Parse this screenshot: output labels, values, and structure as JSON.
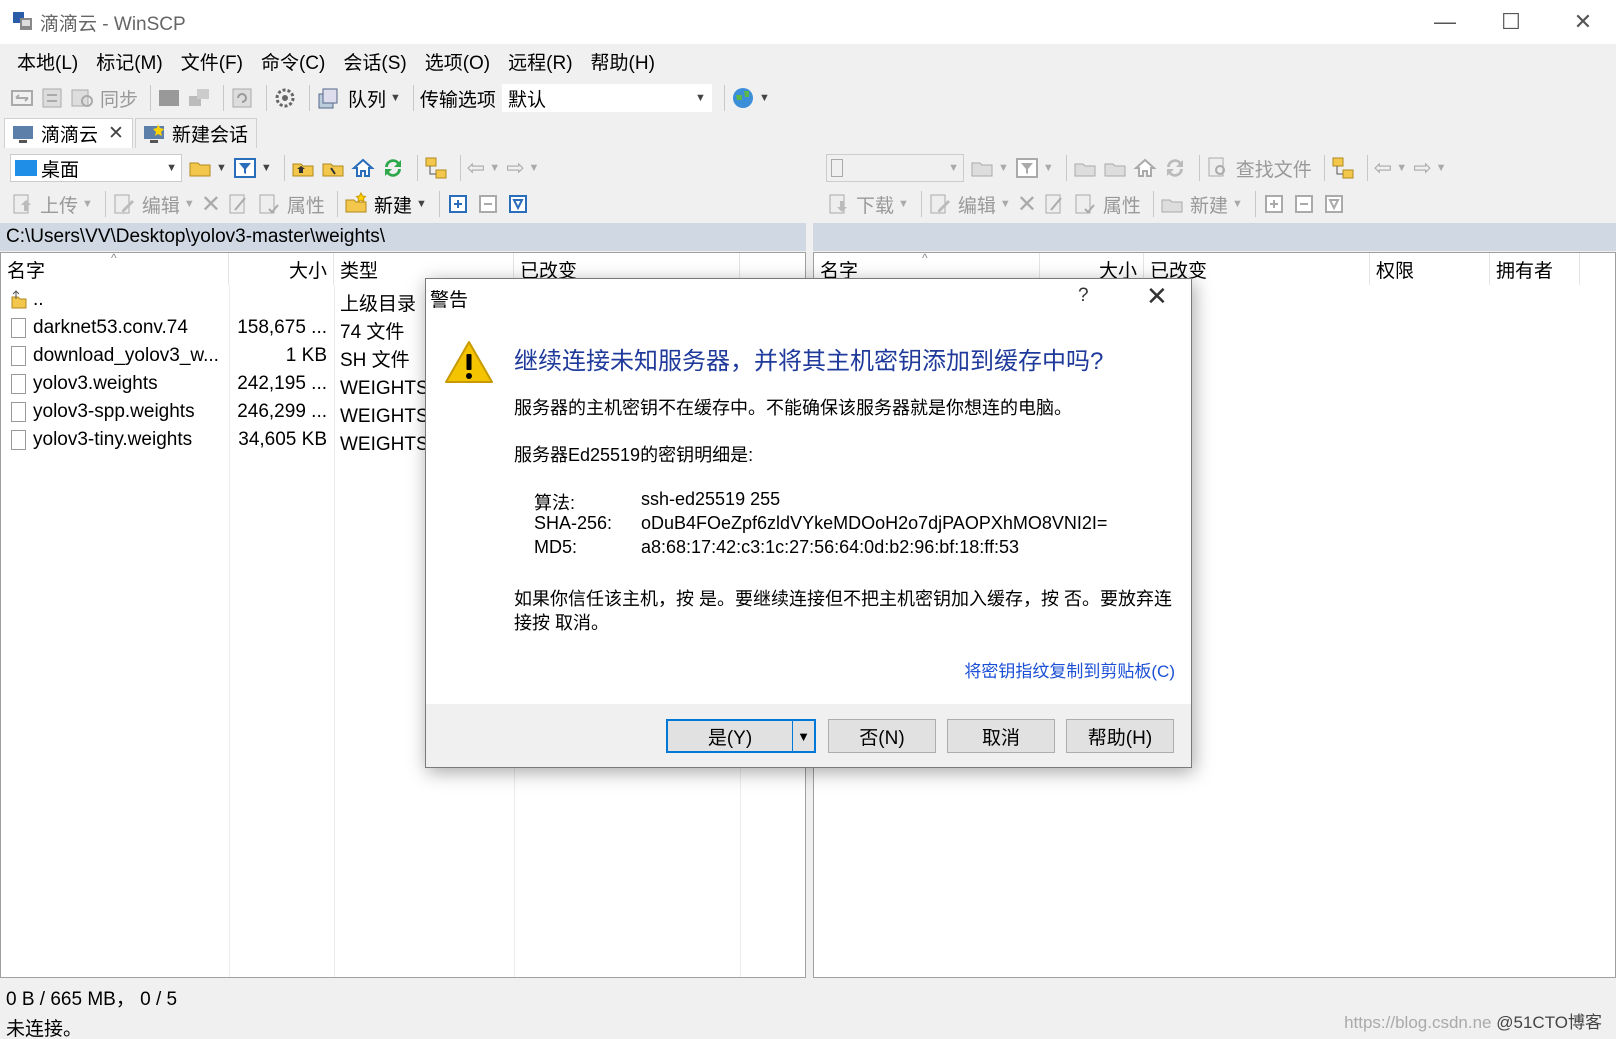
{
  "window": {
    "title": "滴滴云 - WinSCP"
  },
  "menu": [
    "本地(L)",
    "标记(M)",
    "文件(F)",
    "命令(C)",
    "会话(S)",
    "选项(O)",
    "远程(R)",
    "帮助(H)"
  ],
  "toolbar": {
    "sync_label": "同步",
    "queue_label": "队列",
    "transfer_options_label": "传输选项",
    "transfer_preset": "默认"
  },
  "tabs": [
    {
      "label": "滴滴云"
    },
    {
      "label": "新建会话"
    }
  ],
  "local": {
    "location": "桌面",
    "upload_label": "上传",
    "edit_label": "编辑",
    "properties_label": "属性",
    "new_label": "新建",
    "path": "C:\\Users\\VV\\Desktop\\yolov3-master\\weights\\",
    "columns": {
      "name": "名字",
      "size": "大小",
      "type": "类型",
      "changed": "已改变"
    },
    "files": [
      {
        "name": "..",
        "size": "",
        "type": "上级目录"
      },
      {
        "name": "darknet53.conv.74",
        "size": "158,675 ...",
        "type": "74 文件"
      },
      {
        "name": "download_yolov3_w...",
        "size": "1 KB",
        "type": "SH 文件"
      },
      {
        "name": "yolov3.weights",
        "size": "242,195 ...",
        "type": "WEIGHTS 文"
      },
      {
        "name": "yolov3-spp.weights",
        "size": "246,299 ...",
        "type": "WEIGHTS 文"
      },
      {
        "name": "yolov3-tiny.weights",
        "size": "34,605 KB",
        "type": "WEIGHTS 文"
      }
    ]
  },
  "remote": {
    "find_files_label": "查找文件",
    "download_label": "下载",
    "edit_label": "编辑",
    "properties_label": "属性",
    "new_label": "新建",
    "columns": {
      "name": "名字",
      "size": "大小",
      "changed": "已改变",
      "rights": "权限",
      "owner": "拥有者"
    }
  },
  "status": {
    "selection": "0 B / 665 MB， 0 / 5",
    "connection": "未连接。"
  },
  "watermark": {
    "url": "https://blog.csdn.ne",
    "brand": "@51CTO博客"
  },
  "dialog": {
    "title": "警告",
    "help_glyph": "?",
    "close_glyph": "✕",
    "headline": "继续连接未知服务器，并将其主机密钥添加到缓存中吗?",
    "line1": "服务器的主机密钥不在缓存中。不能确保该服务器就是你想连的电脑。",
    "line2": "服务器Ed25519的密钥明细是:",
    "key": {
      "algo_label": "算法:",
      "algo_value": "ssh-ed25519 255",
      "sha_label": "SHA-256:",
      "sha_value": "oDuB4FOeZpf6zldVYkeMDOoH2o7djPAOPXhMO8VNI2I=",
      "md5_label": "MD5:",
      "md5_value": "a8:68:17:42:c3:1c:27:56:64:0d:b2:96:bf:18:ff:53"
    },
    "line3a": "如果你信任该主机，按 是。要继续连接但不把主机密钥加入缓存，按 否。要放弃连",
    "line3b": "接按 取消。",
    "copy_link": "将密钥指纹复制到剪贴板(C)",
    "buttons": {
      "yes": "是(Y)",
      "no": "否(N)",
      "cancel": "取消",
      "help": "帮助(H)"
    }
  },
  "colors": {
    "accent": "#0078d7",
    "headline": "#1f3a9b",
    "link": "#1a4fd6",
    "pathbar": "#cfd8e3",
    "warning": "#f5c400"
  }
}
